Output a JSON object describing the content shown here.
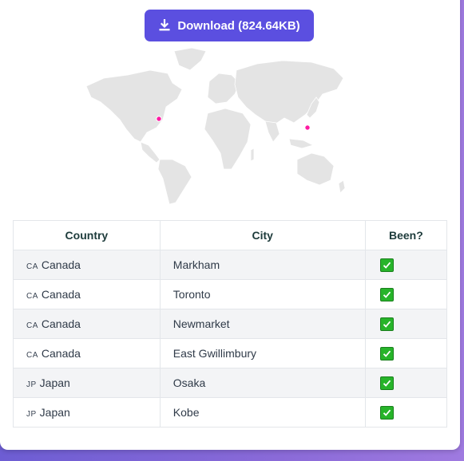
{
  "download": {
    "label": "Download (824.64KB)",
    "icon": "download-icon"
  },
  "map": {
    "pin_color": "#ff1aa3",
    "land_color": "#e4e4e4",
    "border_color": "#ffffff"
  },
  "table": {
    "headers": {
      "country": "Country",
      "city": "City",
      "been": "Been?"
    },
    "rows": [
      {
        "code": "CA",
        "country": "Canada",
        "city": "Markham",
        "been": "check"
      },
      {
        "code": "CA",
        "country": "Canada",
        "city": "Toronto",
        "been": "check"
      },
      {
        "code": "CA",
        "country": "Canada",
        "city": "Newmarket",
        "been": "check"
      },
      {
        "code": "CA",
        "country": "Canada",
        "city": "East Gwillimbury",
        "been": "check"
      },
      {
        "code": "JP",
        "country": "Japan",
        "city": "Osaka",
        "been": "check"
      },
      {
        "code": "JP",
        "country": "Japan",
        "city": "Kobe",
        "been": "check"
      }
    ]
  },
  "colors": {
    "accent": "#5b4fe0",
    "check": "#27b42a"
  }
}
